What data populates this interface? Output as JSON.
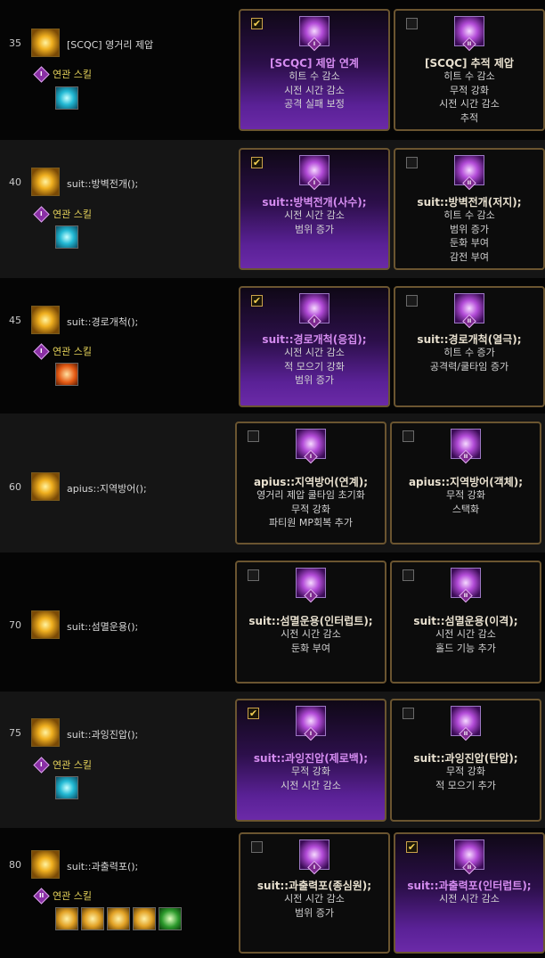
{
  "rows": [
    {
      "level": "35",
      "skill": "[SCQC] 영거리 제압",
      "related_label": "연관 스킬",
      "related_badge": "I",
      "cards": [
        {
          "checked": true,
          "roman": "I",
          "title": "[SCQC] 제압 연계",
          "effects": [
            "히트 수 감소",
            "시전 시간 감소",
            "공격 실패 보정"
          ]
        },
        {
          "checked": false,
          "roman": "II",
          "title": "[SCQC] 추적 제압",
          "effects": [
            "히트 수 감소",
            "무적 강화",
            "시전 시간 감소",
            "추적"
          ]
        }
      ]
    },
    {
      "level": "40",
      "skill": "suit::방벽전개();",
      "related_label": "연관 스킬",
      "related_badge": "I",
      "cards": [
        {
          "checked": true,
          "roman": "I",
          "title": "suit::방벽전개(사수);",
          "effects": [
            "시전 시간 감소",
            "범위 증가"
          ]
        },
        {
          "checked": false,
          "roman": "II",
          "title": "suit::방벽전개(저지);",
          "effects": [
            "히트 수 감소",
            "범위 증가",
            "둔화 부여",
            "감전 부여"
          ]
        }
      ]
    },
    {
      "level": "45",
      "skill": "suit::경로개척();",
      "related_label": "연관 스킬",
      "related_badge": "I",
      "cards": [
        {
          "checked": true,
          "roman": "I",
          "title": "suit::경로개척(응집);",
          "effects": [
            "시전 시간 감소",
            "적 모으기 강화",
            "범위 증가"
          ]
        },
        {
          "checked": false,
          "roman": "II",
          "title": "suit::경로개척(열극);",
          "effects": [
            "히트 수 증가",
            "공격력/쿨타임 증가"
          ]
        }
      ]
    },
    {
      "level": "60",
      "skill": "apius::지역방어();",
      "cards": [
        {
          "checked": false,
          "roman": "I",
          "title": "apius::지역방어(연계);",
          "effects": [
            "영거리 제압 쿨타임 초기화",
            "무적 강화",
            "파티원 MP회복 추가"
          ]
        },
        {
          "checked": false,
          "roman": "II",
          "title": "apius::지역방어(객체);",
          "effects": [
            "무적 강화",
            "스택화"
          ]
        }
      ]
    },
    {
      "level": "70",
      "skill": "suit::섬멸운용();",
      "cards": [
        {
          "checked": false,
          "roman": "I",
          "title": "suit::섬멸운용(인터럽트);",
          "effects": [
            "시전 시간 감소",
            "둔화 부여"
          ]
        },
        {
          "checked": false,
          "roman": "II",
          "title": "suit::섬멸운용(이격);",
          "effects": [
            "시전 시간 감소",
            "홀드 기능 추가"
          ]
        }
      ]
    },
    {
      "level": "75",
      "skill": "suit::과잉진압();",
      "related_label": "연관 스킬",
      "related_badge": "I",
      "cards": [
        {
          "checked": true,
          "roman": "I",
          "title": "suit::과잉진압(제로백);",
          "effects": [
            "무적 강화",
            "시전 시간 감소"
          ]
        },
        {
          "checked": false,
          "roman": "II",
          "title": "suit::과잉진압(탄압);",
          "effects": [
            "무적 강화",
            "적 모으기 추가"
          ]
        }
      ]
    },
    {
      "level": "80",
      "skill": "suit::과출력포();",
      "related_label": "연관 스킬",
      "related_badge": "II",
      "cards": [
        {
          "checked": false,
          "roman": "I",
          "title": "suit::과출력포(종심원);",
          "effects": [
            "시전 시간 감소",
            "범위 증가"
          ]
        },
        {
          "checked": true,
          "roman": "II",
          "title": "suit::과출력포(인터럽트);",
          "effects": [
            "시전 시간 감소"
          ]
        }
      ]
    }
  ]
}
